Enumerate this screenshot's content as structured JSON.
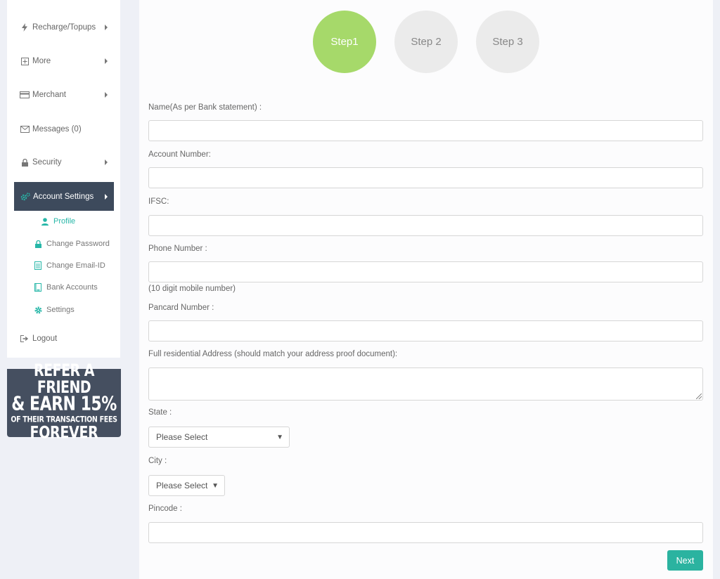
{
  "sidebar": {
    "items": [
      {
        "label": "Recharge/Topups",
        "icon": "bolt-icon"
      },
      {
        "label": "More",
        "icon": "plus-square-icon"
      },
      {
        "label": "Merchant",
        "icon": "credit-card-icon"
      },
      {
        "label": "Messages (0)",
        "icon": "envelope-icon"
      },
      {
        "label": "Security",
        "icon": "lock-icon"
      },
      {
        "label": "Account Settings",
        "icon": "cogs-icon"
      },
      {
        "label": "Logout",
        "icon": "sign-out-icon"
      }
    ],
    "subitems": [
      {
        "label": "Profile",
        "icon": "user-icon"
      },
      {
        "label": "Change Password",
        "icon": "lock-icon"
      },
      {
        "label": "Change Email-ID",
        "icon": "document-icon"
      },
      {
        "label": "Bank Accounts",
        "icon": "bank-book-icon"
      },
      {
        "label": "Settings",
        "icon": "gear-icon"
      }
    ],
    "accent": "#27b7a8",
    "active_bg": "#3d4a5c"
  },
  "banner": {
    "line1": "REFER A FRIEND",
    "line2": "& EARN 15%",
    "line3": "OF THEIR TRANSACTION FEES",
    "line4": "FOREVER"
  },
  "steps": [
    {
      "label": "Step1",
      "active": true
    },
    {
      "label": "Step 2",
      "active": false
    },
    {
      "label": "Step 3",
      "active": false
    }
  ],
  "form": {
    "name_label": "Name(As per Bank statement) :",
    "name_value": "",
    "account_label": "Account Number:",
    "account_value": "",
    "ifsc_label": "IFSC:",
    "ifsc_value": "",
    "phone_label": "Phone Number :",
    "phone_value": "",
    "phone_hint": "(10 digit mobile number)",
    "pancard_label": "Pancard Number :",
    "pancard_value": "",
    "address_label": "Full residential Address (should match your address proof document):",
    "address_value": "",
    "state_label": "State :",
    "state_selected": "Please Select",
    "city_label": "City :",
    "city_selected": "Please Select",
    "pincode_label": "Pincode :",
    "pincode_value": "",
    "next_label": "Next"
  },
  "colors": {
    "step_active": "#a6d96a",
    "step_inactive": "#ebebeb",
    "next_button": "#2bb3a0"
  }
}
